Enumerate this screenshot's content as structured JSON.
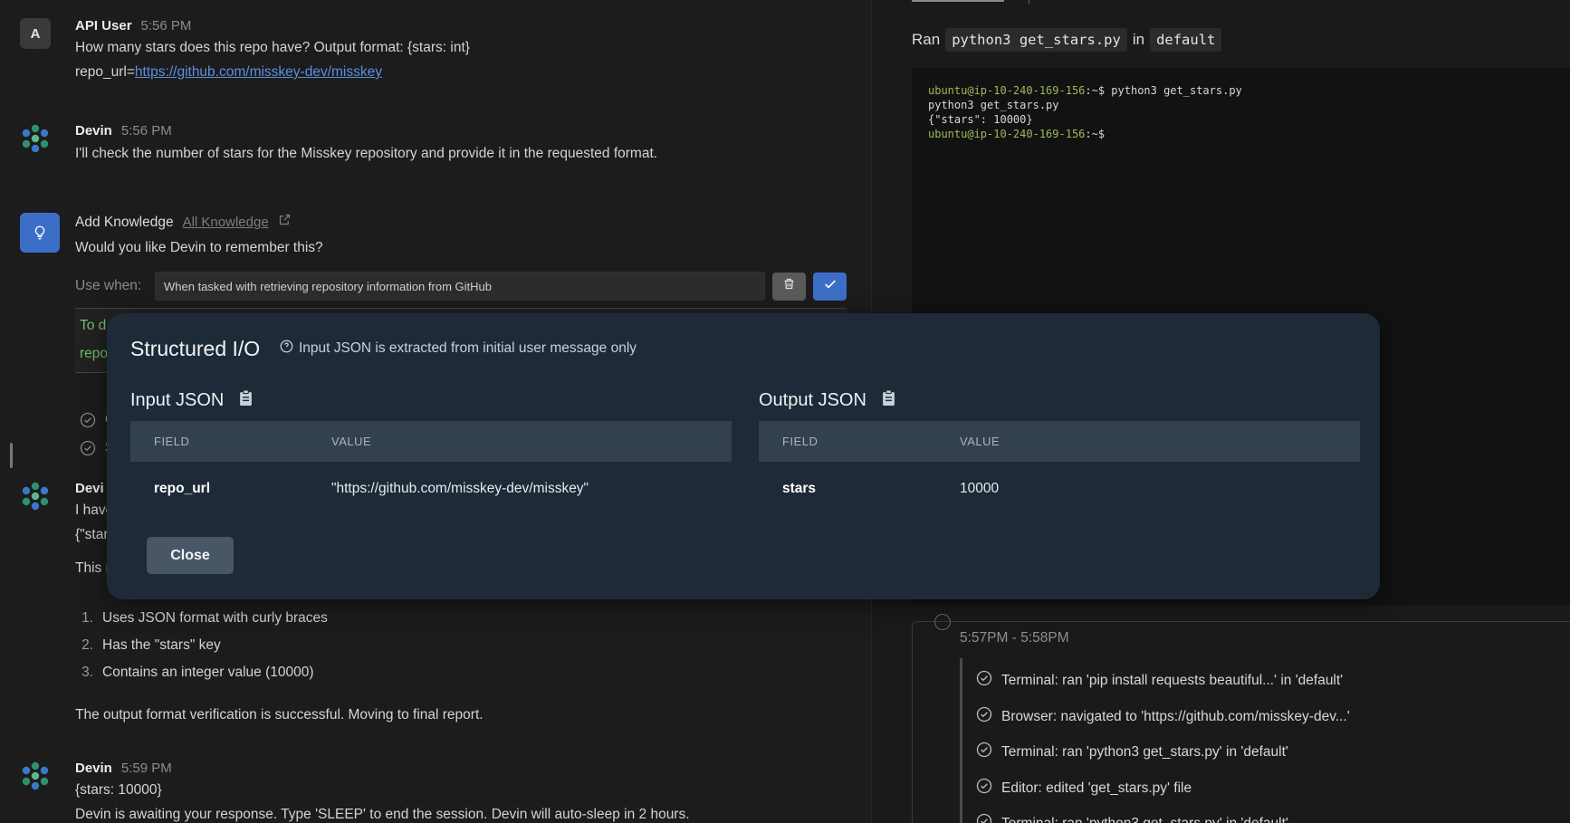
{
  "chat": {
    "msg1": {
      "avatar_letter": "A",
      "author": "API User",
      "time": "5:56 PM",
      "line1": "How many stars does this repo have? Output format: {stars: int}",
      "line2_prefix": "repo_url=",
      "line2_link": "https://github.com/misskey-dev/misskey"
    },
    "msg2": {
      "author": "Devin",
      "time": "5:56 PM",
      "line1": "I'll check the number of stars for the Misskey repository and provide it in the requested format."
    },
    "knowledge": {
      "title": "Add Knowledge",
      "all_link": "All Knowledge",
      "question": "Would you like Devin to remember this?",
      "use_when_label": "Use when:",
      "use_when_value": "When tasked with retrieving repository information from GitHub",
      "green_line1": "To d",
      "green_line2": "repo"
    },
    "partial": {
      "check1": "C",
      "check2": "S",
      "devin_author": "Devi",
      "line1": "I have",
      "line2": "{\"star",
      "line3": "This r"
    },
    "list": [
      {
        "num": "1.",
        "text": "Uses JSON format with curly braces"
      },
      {
        "num": "2.",
        "text": "Has the \"stars\" key"
      },
      {
        "num": "3.",
        "text": "Contains an integer value (10000)"
      }
    ],
    "verification": "The output format verification is successful. Moving to final report.",
    "msg_final": {
      "author": "Devin",
      "time": "5:59 PM",
      "line1": "{stars: 10000}",
      "line2": "Devin is awaiting your response. Type 'SLEEP' to end the session. Devin will auto-sleep in 2 hours."
    }
  },
  "right": {
    "ran_label": "Ran",
    "ran_command": "python3 get_stars.py",
    "ran_in": "in",
    "ran_env": "default",
    "terminal": {
      "prompt": "ubuntu@ip-10-240-169-156",
      "line1_cmd": ":~$ python3 get_stars.py",
      "line2": "python3 get_stars.py",
      "line3": "{\"stars\": 10000}",
      "line4_cmd": ":~$"
    },
    "activity": {
      "time_range": "5:57PM - 5:58PM",
      "items": [
        "Terminal: ran 'pip install requests beautiful...' in 'default'",
        "Browser: navigated to 'https://github.com/misskey-dev...'",
        "Terminal: ran 'python3 get_stars.py' in 'default'",
        "Editor: edited 'get_stars.py' file",
        "Terminal: ran 'python3 get_stars.py' in 'default'"
      ]
    }
  },
  "modal": {
    "title": "Structured I/O",
    "hint": "Input JSON is extracted from initial user message only",
    "input_title": "Input JSON",
    "output_title": "Output JSON",
    "col_field": "FIELD",
    "col_value": "VALUE",
    "input_rows": [
      {
        "field": "repo_url",
        "value": "\"https://github.com/misskey-dev/misskey\""
      }
    ],
    "output_rows": [
      {
        "field": "stars",
        "value": "10000"
      }
    ],
    "close_label": "Close"
  }
}
